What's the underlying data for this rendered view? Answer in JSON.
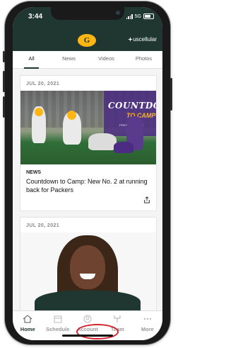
{
  "status_bar": {
    "time": "3:44",
    "network": "5G"
  },
  "header": {
    "logo_letter": "G",
    "sponsor": "uscellular"
  },
  "tabs": [
    {
      "label": "All",
      "active": true
    },
    {
      "label": "News",
      "active": false
    },
    {
      "label": "Videos",
      "active": false
    },
    {
      "label": "Photos",
      "active": false
    }
  ],
  "feed": {
    "cards": [
      {
        "date": "JUL 20, 2021",
        "category": "NEWS",
        "headline": "Countdown to Camp: New No. 2 at running back for Packers",
        "overlay": {
          "line1": "COUNTDOWN",
          "line2": "TO CAMP",
          "line3": "PRESENTED BY"
        }
      },
      {
        "date": "JUL 20, 2021"
      }
    ]
  },
  "bottom_nav": [
    {
      "label": "Home",
      "icon": "home-icon",
      "active": true
    },
    {
      "label": "Schedule",
      "icon": "calendar-icon",
      "active": false
    },
    {
      "label": "Account",
      "icon": "account-icon",
      "active": false
    },
    {
      "label": "Team",
      "icon": "goalpost-icon",
      "active": false
    },
    {
      "label": "More",
      "icon": "more-icon",
      "active": false
    }
  ],
  "colors": {
    "brand_green": "#203731",
    "brand_gold": "#ffb612",
    "highlight_circle": "#d41f2b"
  }
}
